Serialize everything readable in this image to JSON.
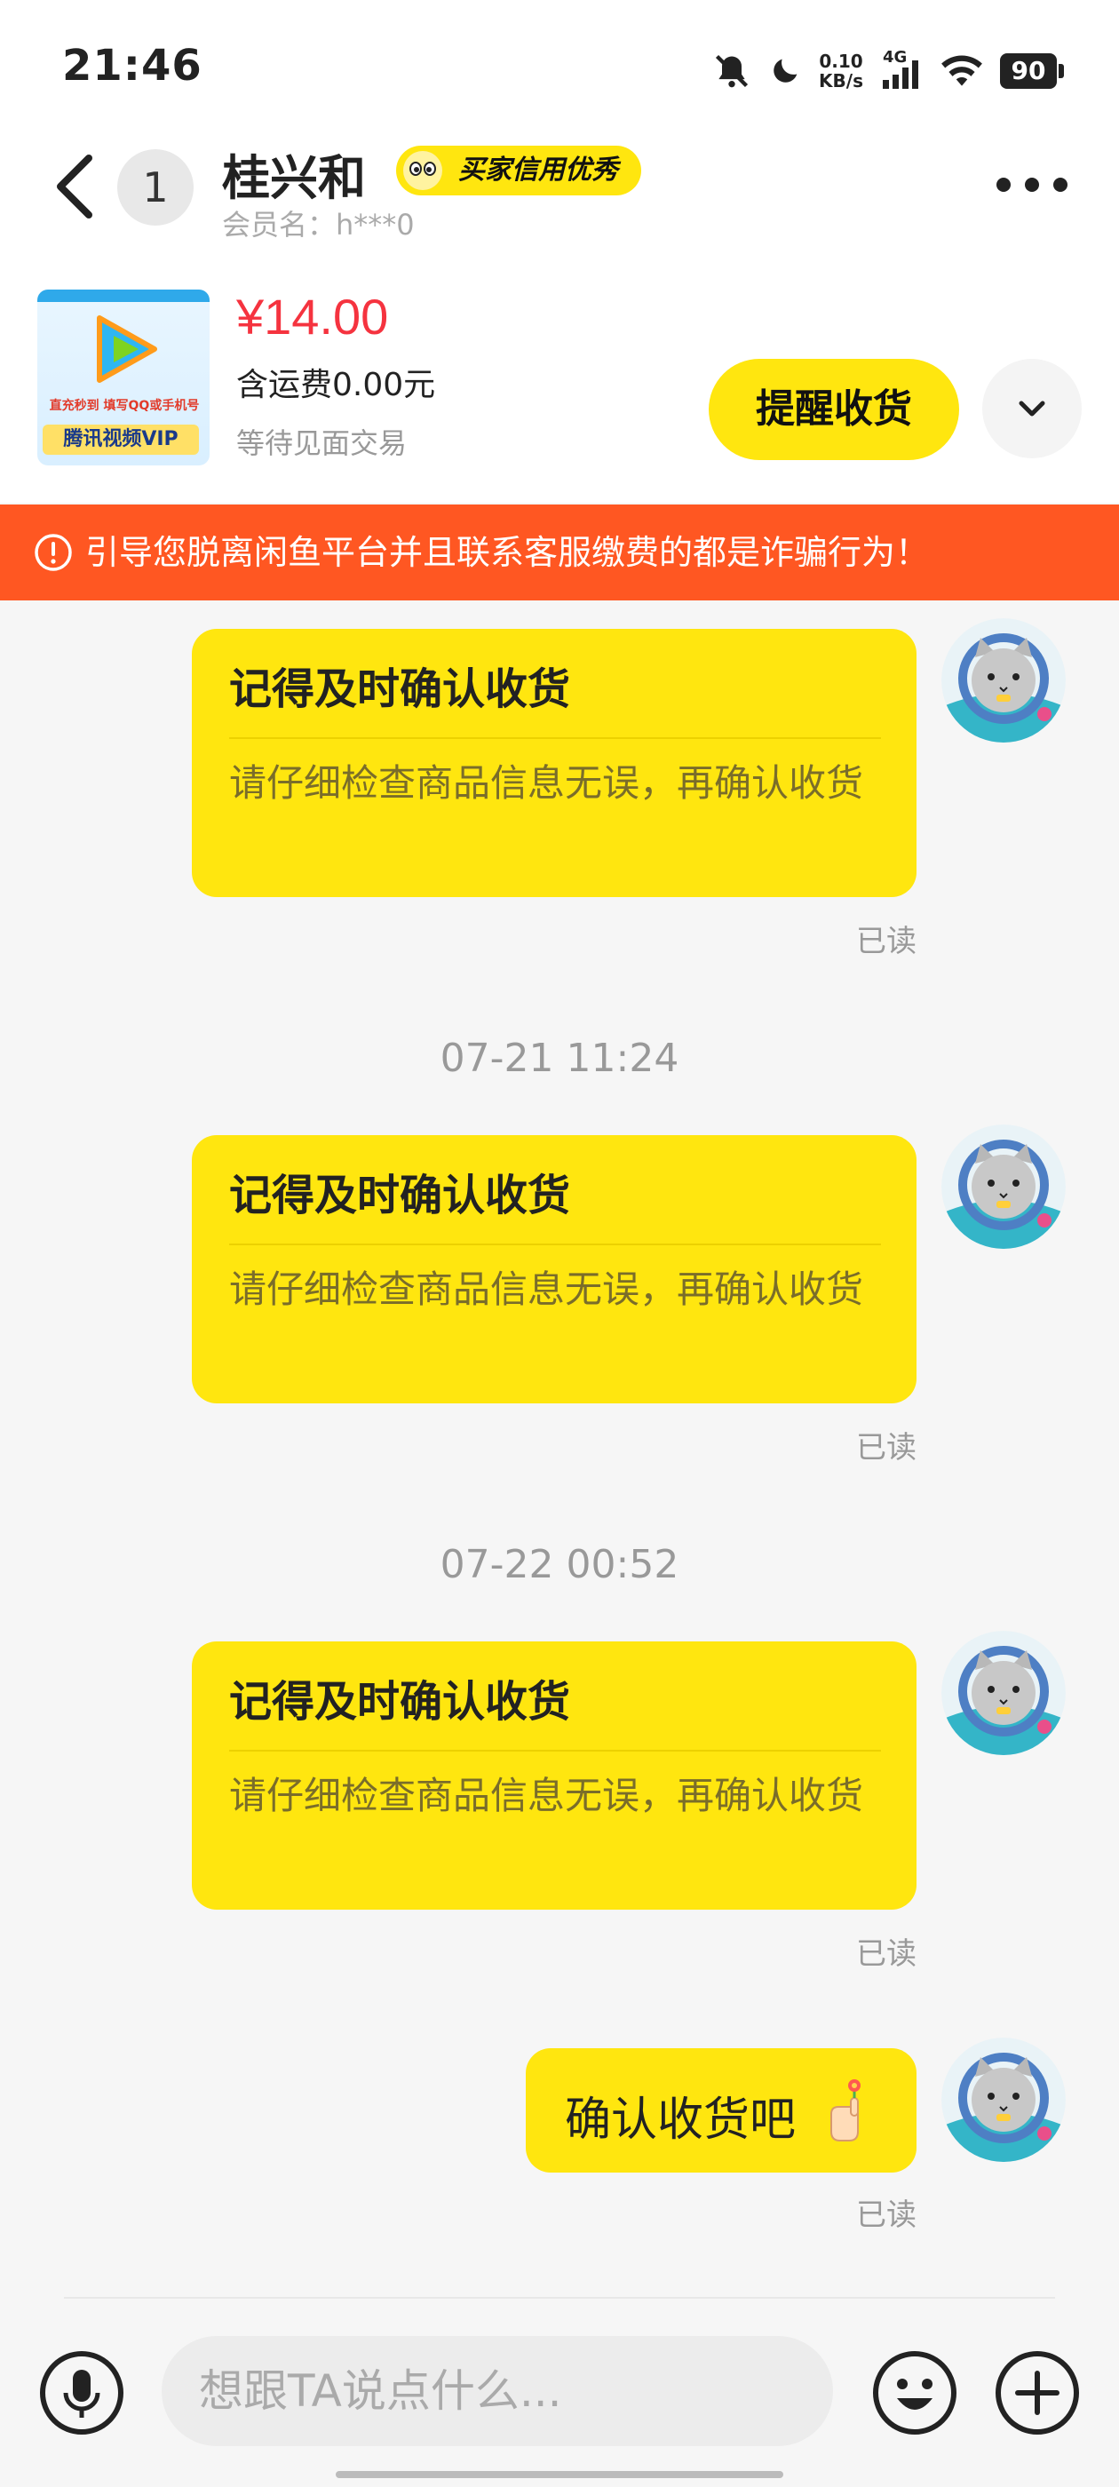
{
  "status_bar": {
    "time": "21:46",
    "net_speed": "0.10",
    "net_unit": "KB/s",
    "net_type": "4G",
    "battery": "90"
  },
  "header": {
    "unread_count": "1",
    "name": "桂兴和",
    "credit_badge": "买家信用优秀",
    "member": "会员名：h***0"
  },
  "product": {
    "image_line1": "直充秒到 填写QQ或手机号",
    "image_line2": "腾讯视频VIP",
    "price": "¥14.00",
    "shipping": "含运费0.00元",
    "status": "等待见面交易",
    "remind_button": "提醒收货"
  },
  "warning": "引导您脱离闲鱼平台并且联系客服缴费的都是诈骗行为！",
  "messages": [
    {
      "title": "记得及时确认收货",
      "body": "请仔细检查商品信息无误，再确认收货",
      "read": "已读"
    },
    {
      "timestamp": "07-21 11:24",
      "title": "记得及时确认收货",
      "body": "请仔细检查商品信息无误，再确认收货",
      "read": "已读"
    },
    {
      "timestamp": "07-22 00:52",
      "title": "记得及时确认收货",
      "body": "请仔细检查商品信息无误，再确认收货",
      "read": "已读"
    },
    {
      "text": "确认收货吧",
      "read": "已读"
    }
  ],
  "input": {
    "placeholder": "想跟TA说点什么..."
  },
  "colors": {
    "accent": "#ffe60f",
    "warning": "#ff5722",
    "price": "#f5333f"
  }
}
